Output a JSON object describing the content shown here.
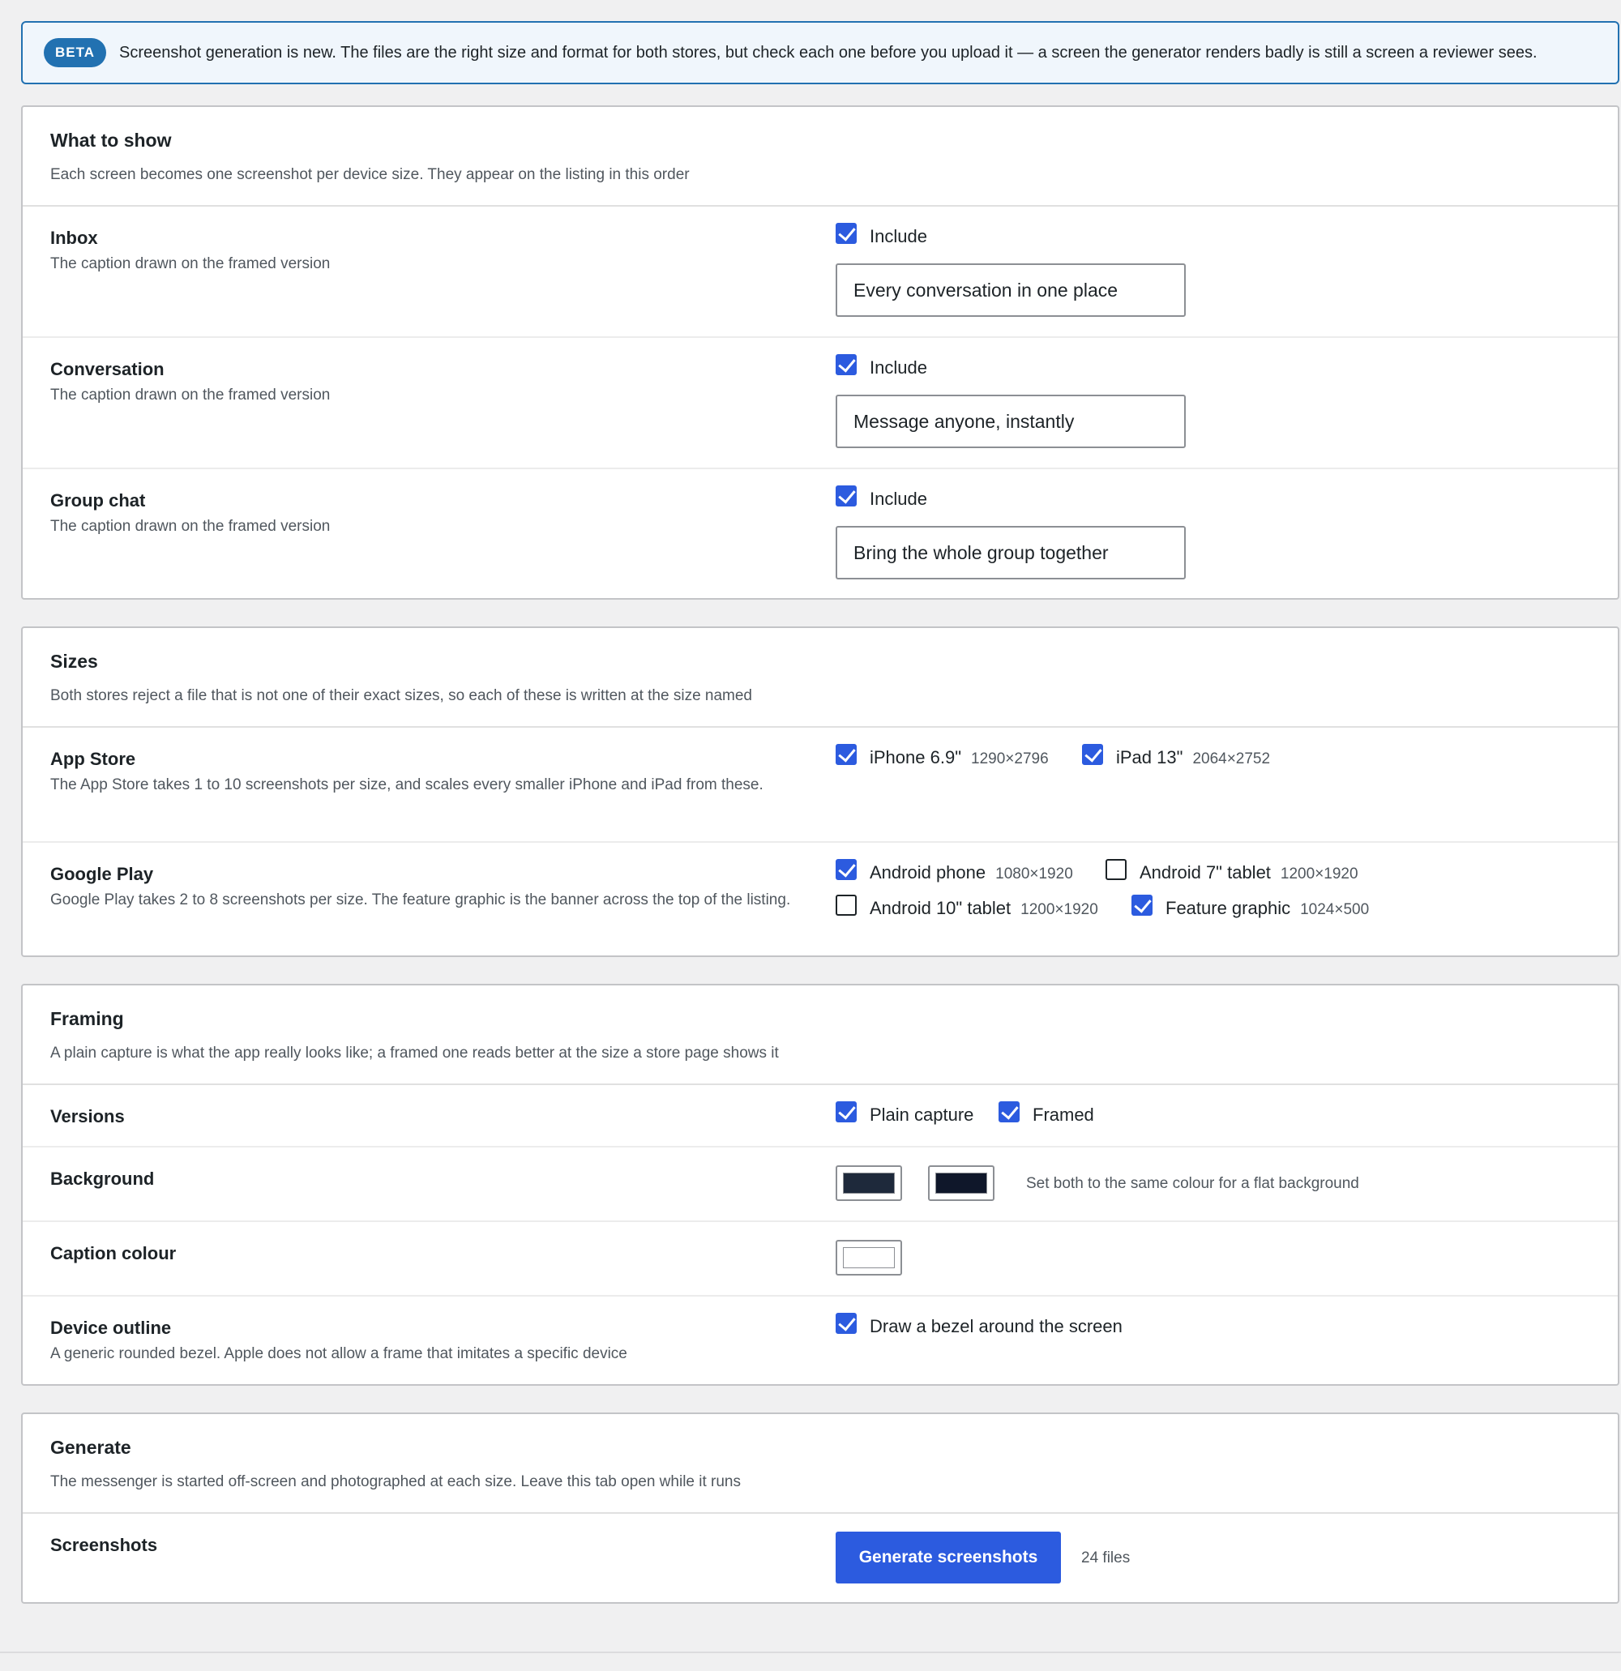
{
  "notice": {
    "badge": "BETA",
    "text": "Screenshot generation is new. The files are the right size and format for both stores, but check each one before you upload it — a screen the generator renders badly is still a screen a reviewer sees."
  },
  "show": {
    "title": "What to show",
    "desc": "Each screen becomes one screenshot per device size. They appear on the listing in this order",
    "screens": [
      {
        "label": "Inbox",
        "desc": "The caption drawn on the framed version",
        "include_label": "Include",
        "included": true,
        "caption": "Every conversation in one place"
      },
      {
        "label": "Conversation",
        "desc": "The caption drawn on the framed version",
        "include_label": "Include",
        "included": true,
        "caption": "Message anyone, instantly"
      },
      {
        "label": "Group chat",
        "desc": "The caption drawn on the framed version",
        "include_label": "Include",
        "included": true,
        "caption": "Bring the whole group together"
      }
    ]
  },
  "sizes": {
    "title": "Sizes",
    "desc": "Both stores reject a file that is not one of their exact sizes, so each of these is written at the size named",
    "app_store": {
      "label": "App Store",
      "desc": "The App Store takes 1 to 10 screenshots per size, and scales every smaller iPhone and iPad from these.",
      "options": [
        {
          "name": "iPhone 6.9\"",
          "dims": "1290×2796",
          "checked": true
        },
        {
          "name": "iPad 13\"",
          "dims": "2064×2752",
          "checked": true
        }
      ]
    },
    "google_play": {
      "label": "Google Play",
      "desc": "Google Play takes 2 to 8 screenshots per size. The feature graphic is the banner across the top of the listing.",
      "options": [
        {
          "name": "Android phone",
          "dims": "1080×1920",
          "checked": true
        },
        {
          "name": "Android 7\" tablet",
          "dims": "1200×1920",
          "checked": false
        },
        {
          "name": "Android 10\" tablet",
          "dims": "1200×1920",
          "checked": false
        },
        {
          "name": "Feature graphic",
          "dims": "1024×500",
          "checked": true
        }
      ]
    }
  },
  "framing": {
    "title": "Framing",
    "desc": "A plain capture is what the app really looks like; a framed one reads better at the size a store page shows it",
    "versions": {
      "label": "Versions",
      "plain": {
        "name": "Plain capture",
        "checked": true
      },
      "framed": {
        "name": "Framed",
        "checked": true
      }
    },
    "background": {
      "label": "Background",
      "color1": "#1e293b",
      "color2": "#0f172a",
      "hint": "Set both to the same colour for a flat background"
    },
    "caption_colour": {
      "label": "Caption colour",
      "color": "#ffffff"
    },
    "device_outline": {
      "label": "Device outline",
      "desc": "A generic rounded bezel. Apple does not allow a frame that imitates a specific device",
      "option": "Draw a bezel around the screen",
      "checked": true
    }
  },
  "generate": {
    "title": "Generate",
    "desc": "The messenger is started off-screen and photographed at each size. Leave this tab open while it runs",
    "row_label": "Screenshots",
    "button": "Generate screenshots",
    "count": "24 files"
  }
}
